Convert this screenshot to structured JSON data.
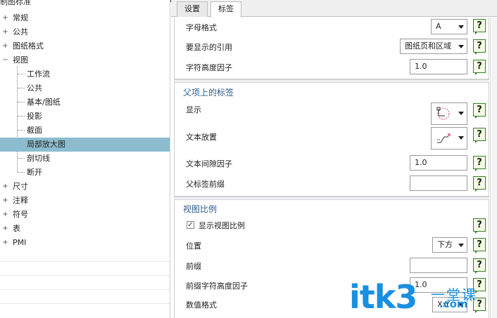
{
  "tree": {
    "title": "制图标准",
    "items": [
      {
        "label": "常规",
        "expander": "+"
      },
      {
        "label": "公共",
        "expander": "+"
      },
      {
        "label": "图纸格式",
        "expander": "+"
      },
      {
        "label": "视图",
        "expander": "−"
      },
      {
        "label": "工作流"
      },
      {
        "label": "公共"
      },
      {
        "label": "基本/图纸"
      },
      {
        "label": "投影"
      },
      {
        "label": "截面"
      },
      {
        "label": "局部放大图",
        "selected": true
      },
      {
        "label": "剖切线"
      },
      {
        "label": "断开"
      },
      {
        "label": "尺寸",
        "expander": "+"
      },
      {
        "label": "注释",
        "expander": "+"
      },
      {
        "label": "符号",
        "expander": "+"
      },
      {
        "label": "表",
        "expander": "+"
      },
      {
        "label": "PMI",
        "expander": "+"
      }
    ]
  },
  "tabs": [
    {
      "label": "设置",
      "active": false
    },
    {
      "label": "标签",
      "active": true
    }
  ],
  "label_settings": {
    "letter_format": {
      "label": "字母格式",
      "value": "A"
    },
    "reference": {
      "label": "要显示的引用",
      "value": "图纸页和区域"
    },
    "char_height_factor": {
      "label": "字符高度因子",
      "value": "1.0"
    }
  },
  "parent_label": {
    "heading": "父项上的标签",
    "display": {
      "label": "显示"
    },
    "text_placement": {
      "label": "文本放置"
    },
    "text_gap_factor": {
      "label": "文本间隙因子",
      "value": "1.0"
    },
    "prefix": {
      "label": "父标签前缀",
      "value": ""
    }
  },
  "view_scale": {
    "heading": "视图比例",
    "show_scale": {
      "label": "显示视图比例",
      "checked": true
    },
    "position": {
      "label": "位置",
      "value": "下方"
    },
    "prefix": {
      "label": "前缀",
      "value": ""
    },
    "prefix_height": {
      "label": "前缀字符高度因子",
      "value": "1.0"
    },
    "value_format": {
      "label": "数值格式",
      "value": "X:Y"
    }
  },
  "help_glyph": "?",
  "watermark": {
    "main": "itk3",
    "sub1": "一堂课",
    "sub2": ".com"
  }
}
